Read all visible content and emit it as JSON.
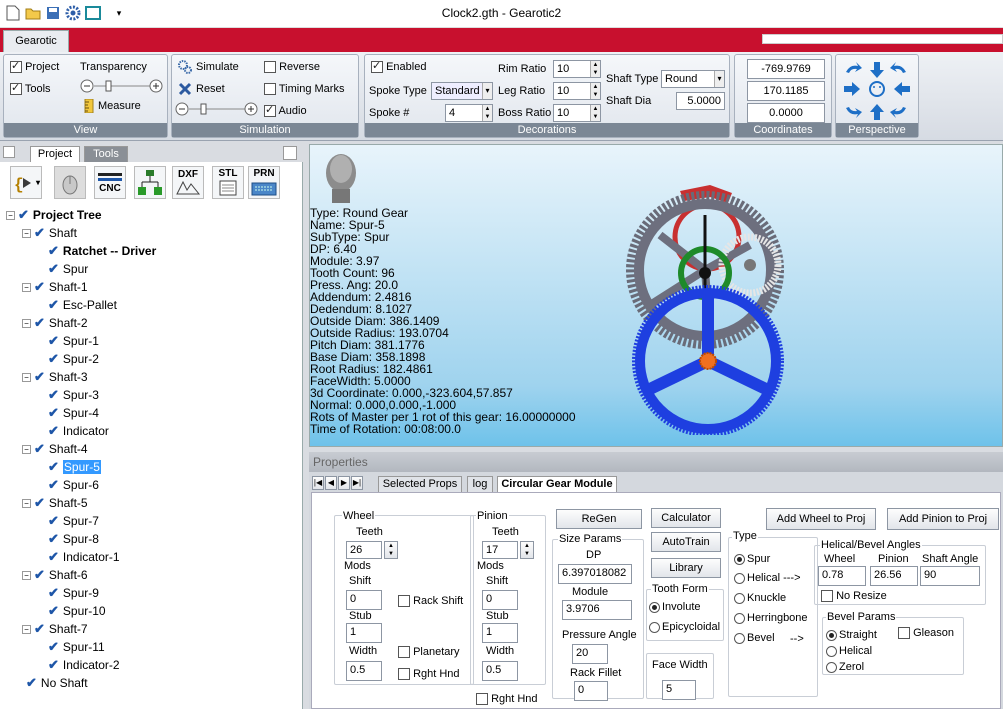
{
  "window": {
    "title": "Clock2.gth - Gearotic2"
  },
  "ribbon": {
    "tab": "Gearotic",
    "view": {
      "caption": "View",
      "project": "Project",
      "tools": "Tools",
      "transparency": "Transparency",
      "measure": "Measure"
    },
    "simulation": {
      "caption": "Simulation",
      "simulate": "Simulate",
      "reset": "Reset",
      "reverse": "Reverse",
      "timing_marks": "Timing Marks",
      "audio": "Audio"
    },
    "decorations": {
      "caption": "Decorations",
      "enabled": "Enabled",
      "spoke_type_label": "Spoke Type",
      "spoke_type_value": "Standard",
      "spoke_num_label": "Spoke #",
      "spoke_num_value": "4",
      "rim_ratio_label": "Rim Ratio",
      "rim_ratio_value": "10",
      "leg_ratio_label": "Leg Ratio",
      "leg_ratio_value": "10",
      "boss_ratio_label": "Boss Ratio",
      "boss_ratio_value": "10",
      "shaft_type_label": "Shaft Type",
      "shaft_type_value": "Round",
      "shaft_dia_label": "Shaft Dia",
      "shaft_dia_value": "5.0000"
    },
    "coordinates": {
      "caption": "Coordinates",
      "x": "-769.9769",
      "y": "170.1185",
      "z": "0.0000"
    },
    "perspective": {
      "caption": "Perspective"
    }
  },
  "left": {
    "tab_project": "Project",
    "tab_tools": "Tools",
    "tools": {
      "cnc": "CNC",
      "dxf": "DXF",
      "stl": "STL",
      "prn": "PRN"
    },
    "tree": [
      {
        "label": "Project Tree",
        "level": 0,
        "bold": true,
        "exp": true
      },
      {
        "label": "Shaft",
        "level": 1,
        "exp": true
      },
      {
        "label": "Ratchet -- Driver",
        "level": 2,
        "bold": true
      },
      {
        "label": "Spur",
        "level": 2
      },
      {
        "label": "Shaft-1",
        "level": 1,
        "exp": true
      },
      {
        "label": "Esc-Pallet",
        "level": 2
      },
      {
        "label": "Shaft-2",
        "level": 1,
        "exp": true
      },
      {
        "label": "Spur-1",
        "level": 2
      },
      {
        "label": "Spur-2",
        "level": 2
      },
      {
        "label": "Shaft-3",
        "level": 1,
        "exp": true
      },
      {
        "label": "Spur-3",
        "level": 2
      },
      {
        "label": "Spur-4",
        "level": 2
      },
      {
        "label": "Indicator",
        "level": 2
      },
      {
        "label": "Shaft-4",
        "level": 1,
        "exp": true
      },
      {
        "label": "Spur-5",
        "level": 2,
        "selected": true
      },
      {
        "label": "Spur-6",
        "level": 2
      },
      {
        "label": "Shaft-5",
        "level": 1,
        "exp": true
      },
      {
        "label": "Spur-7",
        "level": 2
      },
      {
        "label": "Spur-8",
        "level": 2
      },
      {
        "label": "Indicator-1",
        "level": 2
      },
      {
        "label": "Shaft-6",
        "level": 1,
        "exp": true
      },
      {
        "label": "Spur-9",
        "level": 2
      },
      {
        "label": "Spur-10",
        "level": 2
      },
      {
        "label": "Shaft-7",
        "level": 1,
        "exp": true
      },
      {
        "label": "Spur-11",
        "level": 2
      },
      {
        "label": "Indicator-2",
        "level": 2
      },
      {
        "label": "No Shaft",
        "level": 1
      }
    ]
  },
  "viewport": {
    "info": [
      "Type: Round Gear",
      "Name: Spur-5",
      "SubType: Spur",
      "DP: 6.40",
      "Module: 3.97",
      "Tooth Count: 96",
      "Press. Ang: 20.0",
      "Addendum: 2.4816",
      "Dedendum: 8.1027",
      "Outside Diam: 386.1409",
      "Outside Radius: 193.0704",
      "Pitch Diam: 381.1776",
      "Base Diam: 358.1898",
      "Root Radius: 182.4861",
      "FaceWidth: 5.0000",
      "3d Coordinate: 0.000,-323.604,57.857",
      "Normal: 0.000,0.000,-1.000",
      "Rots of Master per 1 rot of this gear: 16.00000000",
      "Time of Rotation: 00:08:00.0"
    ]
  },
  "props": {
    "title": "Properties",
    "tab_selected": "Selected Props",
    "tab_log": "log",
    "tab_module": "Circular Gear Module",
    "wheel": {
      "title": "Wheel",
      "teeth_label": "Teeth",
      "teeth": "26",
      "mods": "Mods",
      "shift_label": "Shift",
      "shift": "0",
      "stub_label": "Stub",
      "stub": "1",
      "width_label": "Width",
      "width": "0.5",
      "rack_shift": "Rack Shift",
      "planetary": "Planetary",
      "rght_hnd": "Rght Hnd"
    },
    "pinion": {
      "title": "Pinion",
      "teeth_label": "Teeth",
      "teeth": "17",
      "mods": "Mods",
      "shift_label": "Shift",
      "shift": "0",
      "stub_label": "Stub",
      "stub": "1",
      "width_label": "Width",
      "width": "0.5",
      "rght_hnd": "Rght Hnd"
    },
    "regen": "ReGen",
    "size_params": "Size Params",
    "dp_label": "DP",
    "dp": "6.397018082",
    "module_label": "Module",
    "module": "3.9706",
    "pressure_label": "Pressure Angle",
    "pressure": "20",
    "rack_fillet_label": "Rack Fillet",
    "rack_fillet": "0",
    "calculator": "Calculator",
    "autotrain": "AutoTrain",
    "library": "Library",
    "tooth_form": "Tooth Form",
    "involute": "Involute",
    "epicycloidal": "Epicycloidal",
    "face_width_label": "Face Width",
    "face_width": "5",
    "add_wheel": "Add Wheel to Proj",
    "add_pinion": "Add Pinion to Proj",
    "type_label": "Type",
    "spur": "Spur",
    "helical": "Helical",
    "knuckle": "Knuckle",
    "herringbone": "Herringbone",
    "bevel": "Bevel",
    "arrow": "--->",
    "arrow2": "-->",
    "hb_title": "Helical/Bevel Angles",
    "hb_wheel_label": "Wheel",
    "hb_wheel": "0.78",
    "hb_pinion_label": "Pinion",
    "hb_pinion": "26.56",
    "hb_shaft_label": "Shaft Angle",
    "hb_shaft": "90",
    "no_resize": "No Resize",
    "bevel_params": "Bevel Params",
    "straight": "Straight",
    "bhelical": "Helical",
    "zerol": "Zerol",
    "gleason": "Gleason"
  }
}
